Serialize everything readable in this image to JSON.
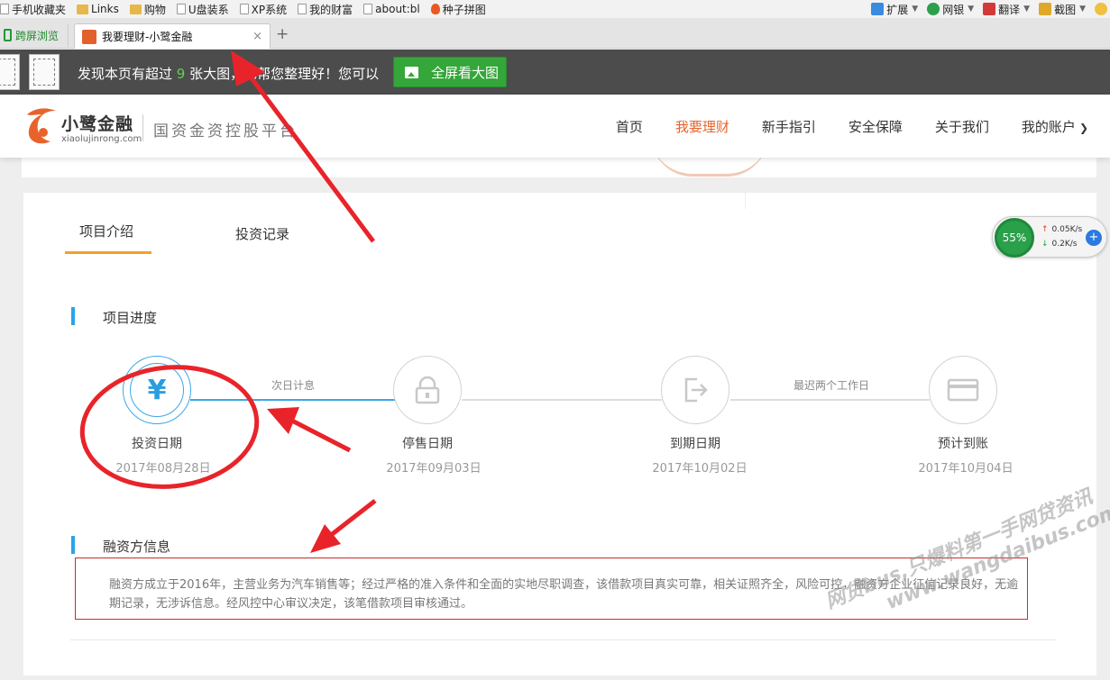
{
  "bookmarks": [
    "手机收藏夹",
    "Links",
    "购物",
    "U盘装系",
    "XP系统",
    "我的财富",
    "about:bl",
    "种子拼图"
  ],
  "toolbar_right": [
    "扩展",
    "网银",
    "翻译",
    "截图"
  ],
  "split_browse": "跨屏浏览",
  "tab": {
    "title": "我要理财-小鹭金融",
    "close": "×",
    "new_tab": "+"
  },
  "image_bar": {
    "prefix": "发现本页有超过",
    "count": "9",
    "suffix": "张大图，已帮您整理好！您可以",
    "button": "全屏看大图"
  },
  "brand": {
    "name": "小鹭金融",
    "domain": "xiaolujinrong.com",
    "slogan": "国资金资控股平台"
  },
  "nav": [
    "首页",
    "我要理财",
    "新手指引",
    "安全保障",
    "关于我们",
    "我的账户"
  ],
  "nav_active": "我要理财",
  "project_tabs": [
    "项目介绍",
    "投资记录"
  ],
  "progress": {
    "title": "项目进度",
    "steps": [
      {
        "label": "投资日期",
        "date": "2017年08月28日"
      },
      {
        "label": "停售日期",
        "date": "2017年09月03日"
      },
      {
        "label": "到期日期",
        "date": "2017年10月02日"
      },
      {
        "label": "预计到账",
        "date": "2017年10月04日"
      }
    ],
    "notes": [
      "次日计息",
      "最迟两个工作日"
    ],
    "yuan_symbol": "¥"
  },
  "financier": {
    "title": "融资方信息",
    "text": "融资方成立于2016年，主营业务为汽车销售等；经过严格的准入条件和全面的实地尽职调查，该借款项目真实可靠，相关证照齐全，风险可控，融资方企业征信记录良好，无逾期记录，无涉诉信息。经风控中心审议决定，该笔借款项目审核通过。"
  },
  "speed_widget": {
    "percent": "55%",
    "up": "0.05K/s",
    "down": "0.2K/s",
    "plus": "+"
  },
  "watermark": {
    "line1": "网贷bus,只爆料第一手网贷资讯",
    "line2": "www.wangdaibus.com"
  },
  "colors": {
    "accent": "#e8632b",
    "blue": "#2aa4e8",
    "green": "#35a63a",
    "annotation_red": "#e8242a"
  }
}
